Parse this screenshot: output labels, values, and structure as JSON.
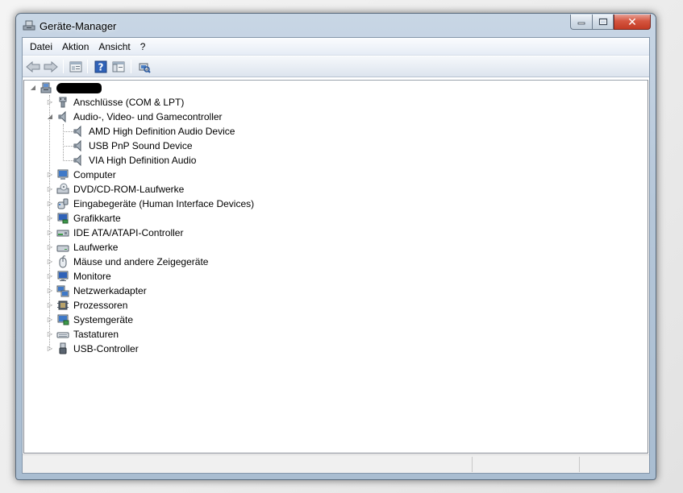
{
  "window": {
    "title": "Geräte-Manager",
    "close_glyph": "✕"
  },
  "menu": [
    "Datei",
    "Aktion",
    "Ansicht",
    "?"
  ],
  "toolbar": {
    "buttons": [
      "back-arrow-icon",
      "forward-arrow-icon",
      "properties-icon",
      "help-icon",
      "console-tree-icon",
      "scan-hardware-icon"
    ],
    "help_glyph": "?"
  },
  "tree": {
    "root_label_redacted": true,
    "categories": [
      {
        "label": "Anschlüsse (COM & LPT)",
        "icon": "port-icon",
        "expanded": false
      },
      {
        "label": "Audio-, Video- und Gamecontroller",
        "icon": "speaker-icon",
        "expanded": true,
        "children": [
          "AMD High Definition Audio Device",
          "USB PnP Sound Device",
          "VIA High Definition Audio"
        ]
      },
      {
        "label": "Computer",
        "icon": "computer-icon",
        "expanded": false
      },
      {
        "label": "DVD/CD-ROM-Laufwerke",
        "icon": "dvd-drive-icon",
        "expanded": false
      },
      {
        "label": "Eingabegeräte (Human Interface Devices)",
        "icon": "hid-icon",
        "expanded": false
      },
      {
        "label": "Grafikkarte",
        "icon": "display-adapter-icon",
        "expanded": false
      },
      {
        "label": "IDE ATA/ATAPI-Controller",
        "icon": "ide-controller-icon",
        "expanded": false
      },
      {
        "label": "Laufwerke",
        "icon": "disk-drive-icon",
        "expanded": false
      },
      {
        "label": "Mäuse und andere Zeigegeräte",
        "icon": "mouse-icon",
        "expanded": false
      },
      {
        "label": "Monitore",
        "icon": "monitor-icon",
        "expanded": false
      },
      {
        "label": "Netzwerkadapter",
        "icon": "network-adapter-icon",
        "expanded": false
      },
      {
        "label": "Prozessoren",
        "icon": "processor-icon",
        "expanded": false
      },
      {
        "label": "Systemgeräte",
        "icon": "system-devices-icon",
        "expanded": false
      },
      {
        "label": "Tastaturen",
        "icon": "keyboard-icon",
        "expanded": false
      },
      {
        "label": "USB-Controller",
        "icon": "usb-controller-icon",
        "expanded": false
      }
    ]
  },
  "colors": {
    "title_bar": "#b6c7d9",
    "close_button": "#d5553f",
    "menubar": "#e6ecf5",
    "tree_background": "#ffffff"
  }
}
